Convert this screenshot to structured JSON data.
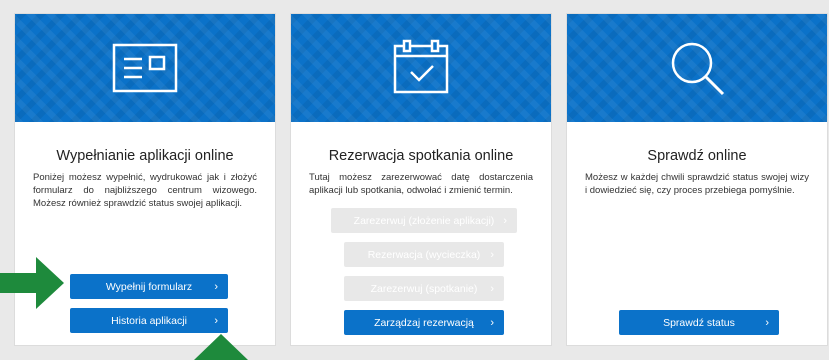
{
  "cards": [
    {
      "title": "Wypełnianie aplikacji online",
      "description": "Poniżej możesz wypełnić, wydrukować jak i złożyć formularz do najbliższego centrum wizowego. Możesz również sprawdzić status swojej aplikacji.",
      "icon": "form-icon",
      "buttons": [
        {
          "label": "Wypełnij formularz",
          "enabled": true
        },
        {
          "label": "Historia aplikacji",
          "enabled": true
        }
      ]
    },
    {
      "title": "Rezerwacja spotkania online",
      "description": "Tutaj możesz zarezerwować datę dostarczenia aplikacji lub spotkania, odwołać i zmienić termin.",
      "icon": "calendar-check-icon",
      "buttons": [
        {
          "label": "Zarezerwuj (złożenie aplikacji)",
          "enabled": false
        },
        {
          "label": "Rezerwacja (wycieczka)",
          "enabled": false
        },
        {
          "label": "Zarezerwuj (spotkanie)",
          "enabled": false
        },
        {
          "label": "Zarządzaj rezerwacją",
          "enabled": true
        }
      ]
    },
    {
      "title": "Sprawdź online",
      "description": "Możesz w każdej chwili sprawdzić status swojej wizy i dowiedzieć się, czy proces przebiega pomyślnie.",
      "icon": "magnifier-icon",
      "buttons": [
        {
          "label": "Sprawdź status",
          "enabled": true
        }
      ]
    }
  ],
  "chevron": "›",
  "colors": {
    "primary": "#0b72c9",
    "disabled": "#e8e8e8",
    "annotation_arrow": "#1e8a3c",
    "background": "#e9e9e9"
  },
  "annotations": [
    {
      "icon": "green-arrow-right-icon",
      "points_to": "Wypełnij formularz"
    },
    {
      "icon": "green-arrow-up-icon",
      "points_to": "Historia aplikacji"
    }
  ]
}
